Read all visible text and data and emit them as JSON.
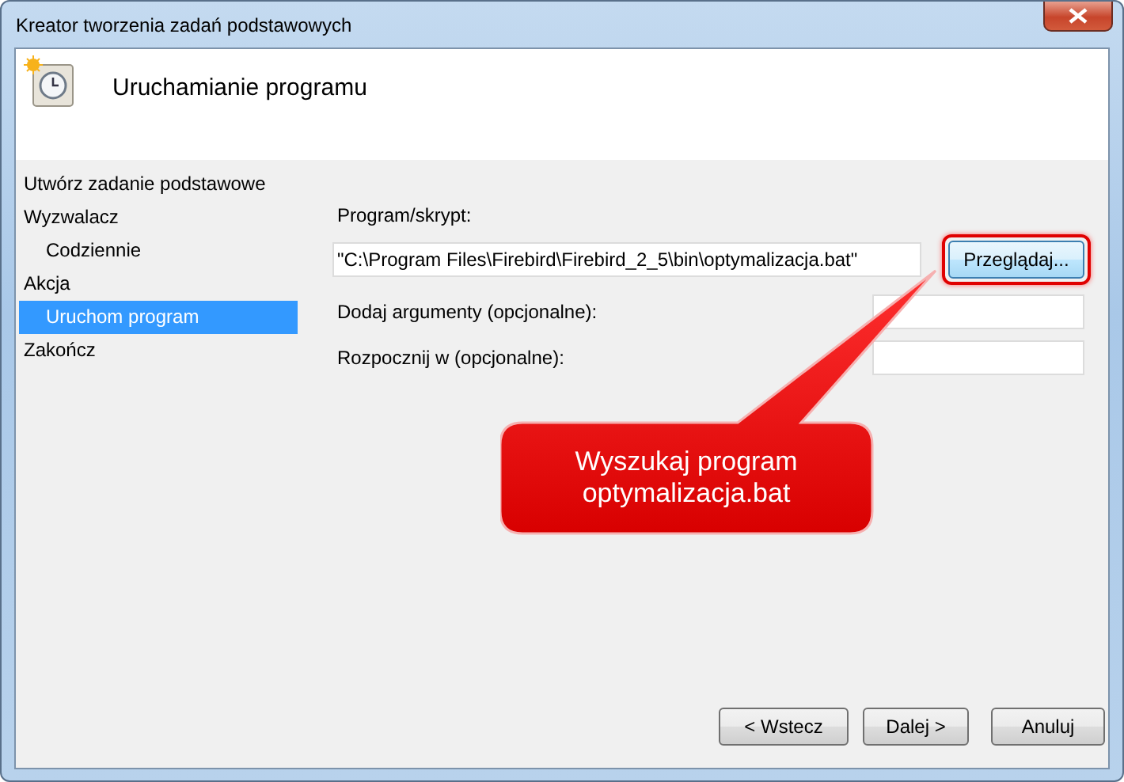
{
  "window": {
    "title": "Kreator tworzenia zadań podstawowych"
  },
  "header": {
    "title": "Uruchamianie programu"
  },
  "nav": [
    {
      "label": "Utwórz zadanie podstawowe",
      "selected": false
    },
    {
      "label": "Wyzwalacz",
      "selected": false,
      "children": [
        {
          "label": "Codziennie",
          "selected": false
        }
      ]
    },
    {
      "label": "Akcja",
      "selected": false,
      "children": [
        {
          "label": "Uruchom program",
          "selected": true
        }
      ]
    },
    {
      "label": "Zakończ",
      "selected": false
    }
  ],
  "form": {
    "program_label": "Program/skrypt:",
    "program_value": "\"C:\\Program Files\\Firebird\\Firebird_2_5\\bin\\optymalizacja.bat\"",
    "browse": {
      "label": "Przeglądaj...",
      "highlighted": true
    },
    "fields": [
      {
        "label": "Dodaj argumenty (opcjonalne):"
      },
      {
        "label": "Rozpocznij w (opcjonalne):"
      }
    ]
  },
  "callout": {
    "text": "Wyszukaj program optymalizacja.bat"
  },
  "buttons": [
    "< Wstecz",
    "Dalej >",
    "Anuluj"
  ]
}
